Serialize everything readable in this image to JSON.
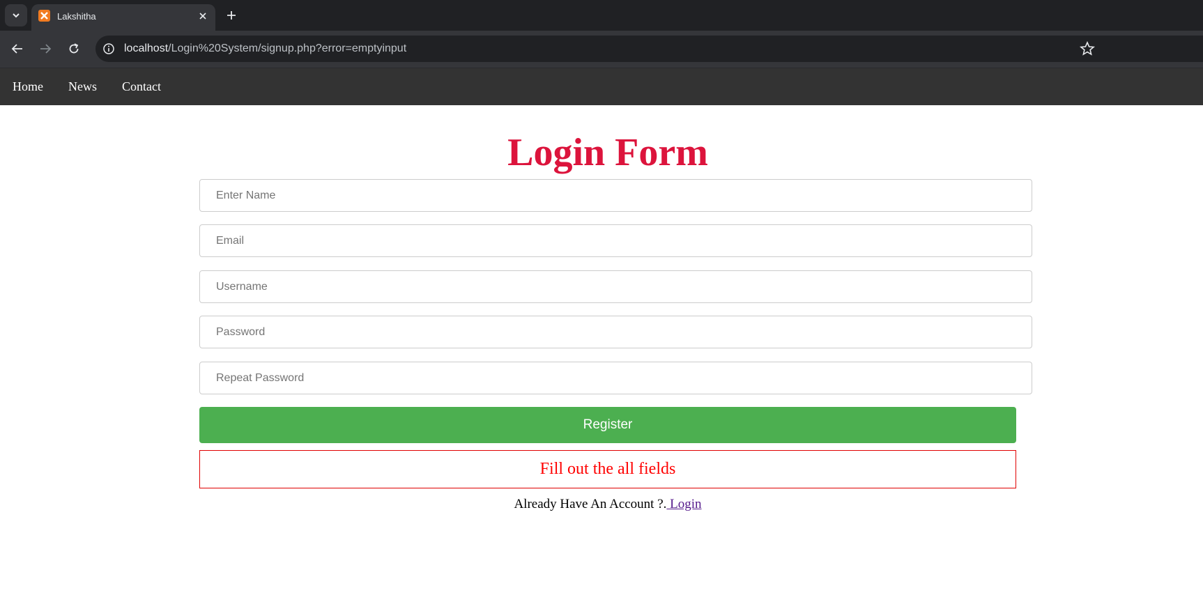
{
  "browser": {
    "tab_title": "Lakshitha",
    "url_host": "localhost",
    "url_path": "/Login%20System/signup.php?error=emptyinput",
    "icons": {
      "tab_list": "chevron-down-icon",
      "favicon": "xampp-icon",
      "tab_close": "close-icon",
      "new_tab": "plus-icon",
      "back": "back-arrow-icon",
      "forward": "forward-arrow-icon",
      "reload": "reload-icon",
      "site_info": "info-icon",
      "bookmark": "star-icon"
    }
  },
  "nav": {
    "items": [
      {
        "label": "Home"
      },
      {
        "label": "News"
      },
      {
        "label": "Contact"
      }
    ]
  },
  "form": {
    "title": "Login Form",
    "fields": [
      {
        "placeholder": "Enter Name",
        "value": ""
      },
      {
        "placeholder": "Email",
        "value": ""
      },
      {
        "placeholder": "Username",
        "value": ""
      },
      {
        "placeholder": "Password",
        "value": ""
      },
      {
        "placeholder": "Repeat Password",
        "value": ""
      }
    ],
    "submit_label": "Register",
    "error_message": "Fill out the all fields",
    "account_prompt": "Already Have An Account ?.",
    "login_link": " Login"
  },
  "colors": {
    "title": "#dc143c",
    "button": "#4caf50",
    "error": "#ff0000",
    "nav_bg": "#333333"
  }
}
